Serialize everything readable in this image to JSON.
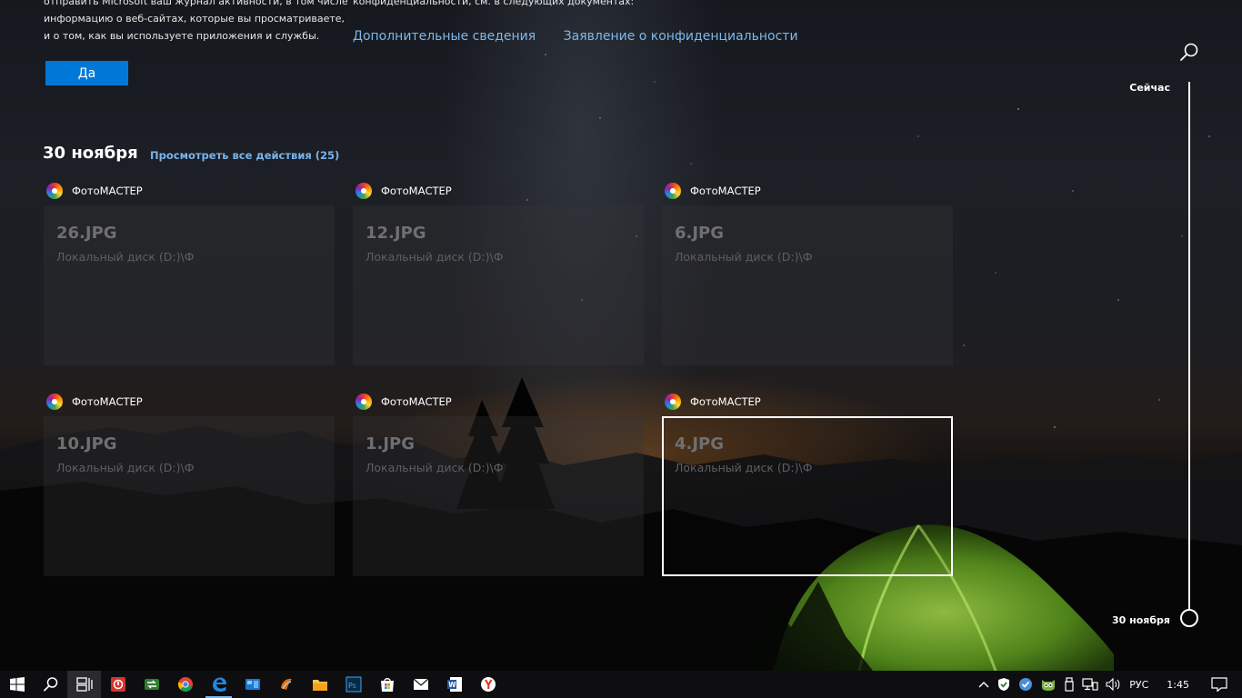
{
  "consent": {
    "left_lines": [
      "отправить Microsoft ваш журнал активности, в том числе",
      "информацию о веб-сайтах, которые вы просматриваете,",
      "и о том, как вы используете приложения и службы."
    ],
    "right_line": "конфиденциальности, см. в следующих документах:",
    "link_more": "Дополнительные сведения",
    "link_privacy": "Заявление о конфиденциальности",
    "yes_button": "Да"
  },
  "section": {
    "date": "30 ноября",
    "view_all": "Просмотреть все действия (25)"
  },
  "cards": [
    {
      "app": "ФотоМАСТЕР",
      "title": "26.JPG",
      "path": "Локальный диск (D:)\\Ф",
      "selected": false
    },
    {
      "app": "ФотоМАСТЕР",
      "title": "12.JPG",
      "path": "Локальный диск (D:)\\Ф",
      "selected": false
    },
    {
      "app": "ФотоМАСТЕР",
      "title": "6.JPG",
      "path": "Локальный диск (D:)\\Ф",
      "selected": false
    },
    {
      "app": "ФотоМАСТЕР",
      "title": "10.JPG",
      "path": "Локальный диск (D:)\\Ф",
      "selected": false
    },
    {
      "app": "ФотоМАСТЕР",
      "title": "1.JPG",
      "path": "Локальный диск (D:)\\Ф",
      "selected": false
    },
    {
      "app": "ФотоМАСТЕР",
      "title": "4.JPG",
      "path": "Локальный диск (D:)\\Ф",
      "selected": true
    }
  ],
  "timeline": {
    "top_label": "Сейчас",
    "bottom_label": "30 ноября",
    "search_icon": "search-icon"
  },
  "taskbar": {
    "apps": [
      "start-icon",
      "search-icon",
      "task-view-icon",
      "app-red-icon",
      "app-green-arrows-icon",
      "chrome-icon",
      "edge-icon",
      "explorer-blue-icon",
      "app-orange-icon",
      "file-explorer-icon",
      "photoshop-icon",
      "store-icon",
      "mail-icon",
      "word-icon",
      "yandex-icon"
    ],
    "tray": {
      "language": "РУС",
      "time": "1:45"
    }
  },
  "colors": {
    "accent": "#0078d7",
    "link": "#7fb7ec",
    "card_bg": "#343438"
  }
}
